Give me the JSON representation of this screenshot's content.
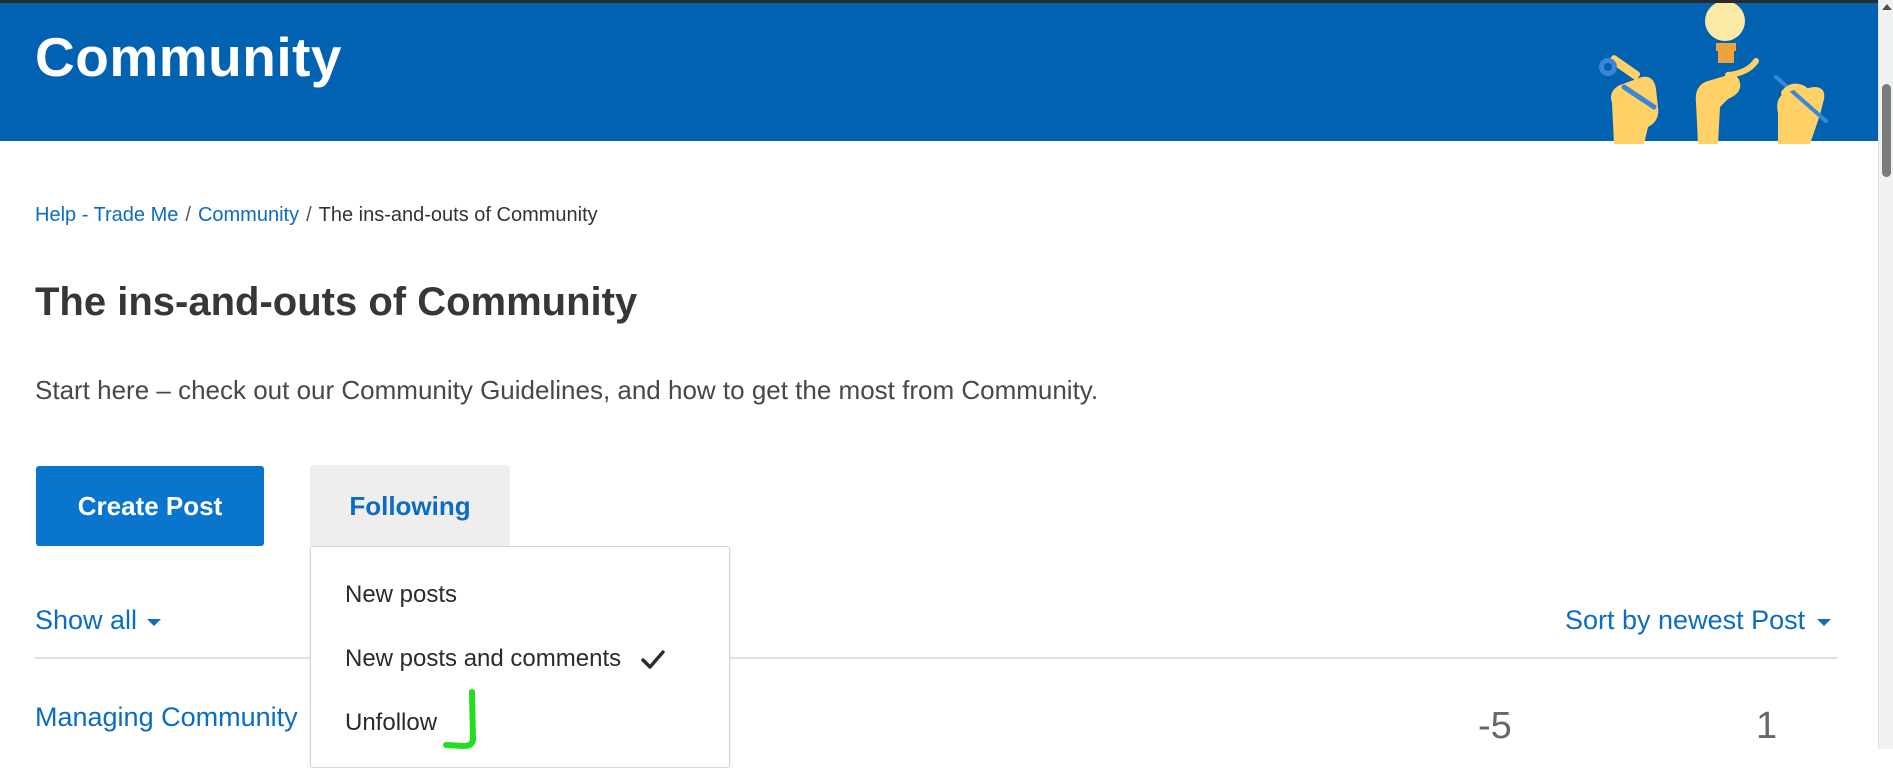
{
  "header": {
    "title": "Community"
  },
  "breadcrumb": {
    "items": [
      {
        "label": "Help - Trade Me"
      },
      {
        "label": "Community"
      },
      {
        "label": "The ins-and-outs of Community"
      }
    ],
    "separator": "/"
  },
  "page": {
    "title": "The ins-and-outs of Community",
    "description": "Start here – check out our Community Guidelines, and how to get the most from Community."
  },
  "actions": {
    "create_post_label": "Create Post",
    "following_label": "Following"
  },
  "filters": {
    "show_all_label": "Show all",
    "sort_label": "Sort by newest Post"
  },
  "following_menu": {
    "options": [
      {
        "label": "New posts",
        "selected": false
      },
      {
        "label": "New posts and comments",
        "selected": true
      },
      {
        "label": "Unfollow",
        "selected": false
      }
    ]
  },
  "posts": [
    {
      "title": "Managing Community",
      "score": "-5",
      "count": "1"
    }
  ],
  "colors": {
    "header_bg": "#0062b1",
    "primary_button": "#0a75cc",
    "link": "#0a6cc2",
    "highlight_mark": "#22dd22"
  },
  "icons": {
    "header_illustration": "hands-with-tools-and-lightbulb-illustration",
    "dropdown_caret": "caret-down-icon",
    "selected_option": "checkmark-icon"
  }
}
